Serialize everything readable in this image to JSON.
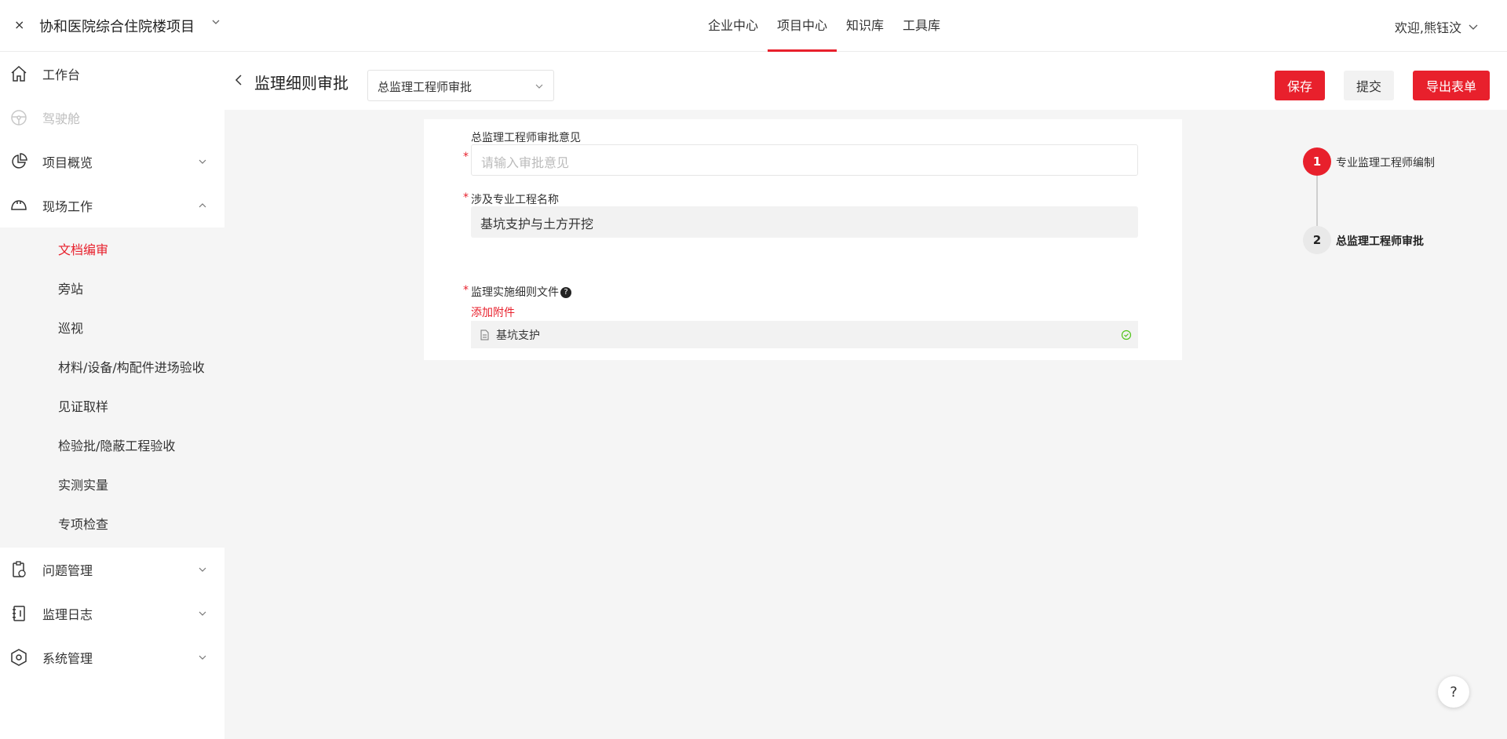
{
  "header": {
    "close_glyph": "×",
    "project_title": "协和医院综合住院楼项目",
    "nav": [
      {
        "label": "企业中心"
      },
      {
        "label": "项目中心"
      },
      {
        "label": "知识库"
      },
      {
        "label": "工具库"
      }
    ],
    "active_nav": "项目中心",
    "welcome": "欢迎,熊钰汶"
  },
  "sidebar": {
    "items": [
      {
        "label": "工作台",
        "icon": "home-icon"
      },
      {
        "label": "驾驶舱",
        "icon": "steering-wheel-icon",
        "disabled": true
      },
      {
        "label": "项目概览",
        "icon": "pie-chart-icon"
      },
      {
        "label": "现场工作",
        "icon": "hard-hat-icon",
        "expanded": true
      },
      {
        "label": "问题管理",
        "icon": "clipboard-question-icon"
      },
      {
        "label": "监理日志",
        "icon": "notebook-icon"
      },
      {
        "label": "系统管理",
        "icon": "hexagon-settings-icon"
      }
    ],
    "submenu": [
      {
        "label": "文档编审",
        "active": true
      },
      {
        "label": "旁站"
      },
      {
        "label": "巡视"
      },
      {
        "label": "材料/设备/构配件进场验收"
      },
      {
        "label": "见证取样"
      },
      {
        "label": "检验批/隐蔽工程验收"
      },
      {
        "label": "实测实量"
      },
      {
        "label": "专项检查"
      }
    ]
  },
  "content_header": {
    "title": "监理细则审批",
    "stage_select": "总监理工程师审批",
    "save": "保存",
    "submit": "提交",
    "export": "导出表单"
  },
  "form": {
    "opinion_label": "总监理工程师审批意见",
    "opinion_placeholder": "请输入审批意见",
    "project_name_label": "涉及专业工程名称",
    "project_name_value": "基坑支护与土方开挖",
    "file_label": "监理实施细则文件",
    "add_attachment": "添加附件",
    "file_name": "基坑支护",
    "required_mark": "*"
  },
  "steps": [
    {
      "number": "1",
      "label": "专业监理工程师编制"
    },
    {
      "number": "2",
      "label": "总监理工程师审批"
    }
  ],
  "help_glyph": "?",
  "colors": {
    "accent": "#e8202c",
    "bg": "#f5f5f5"
  }
}
